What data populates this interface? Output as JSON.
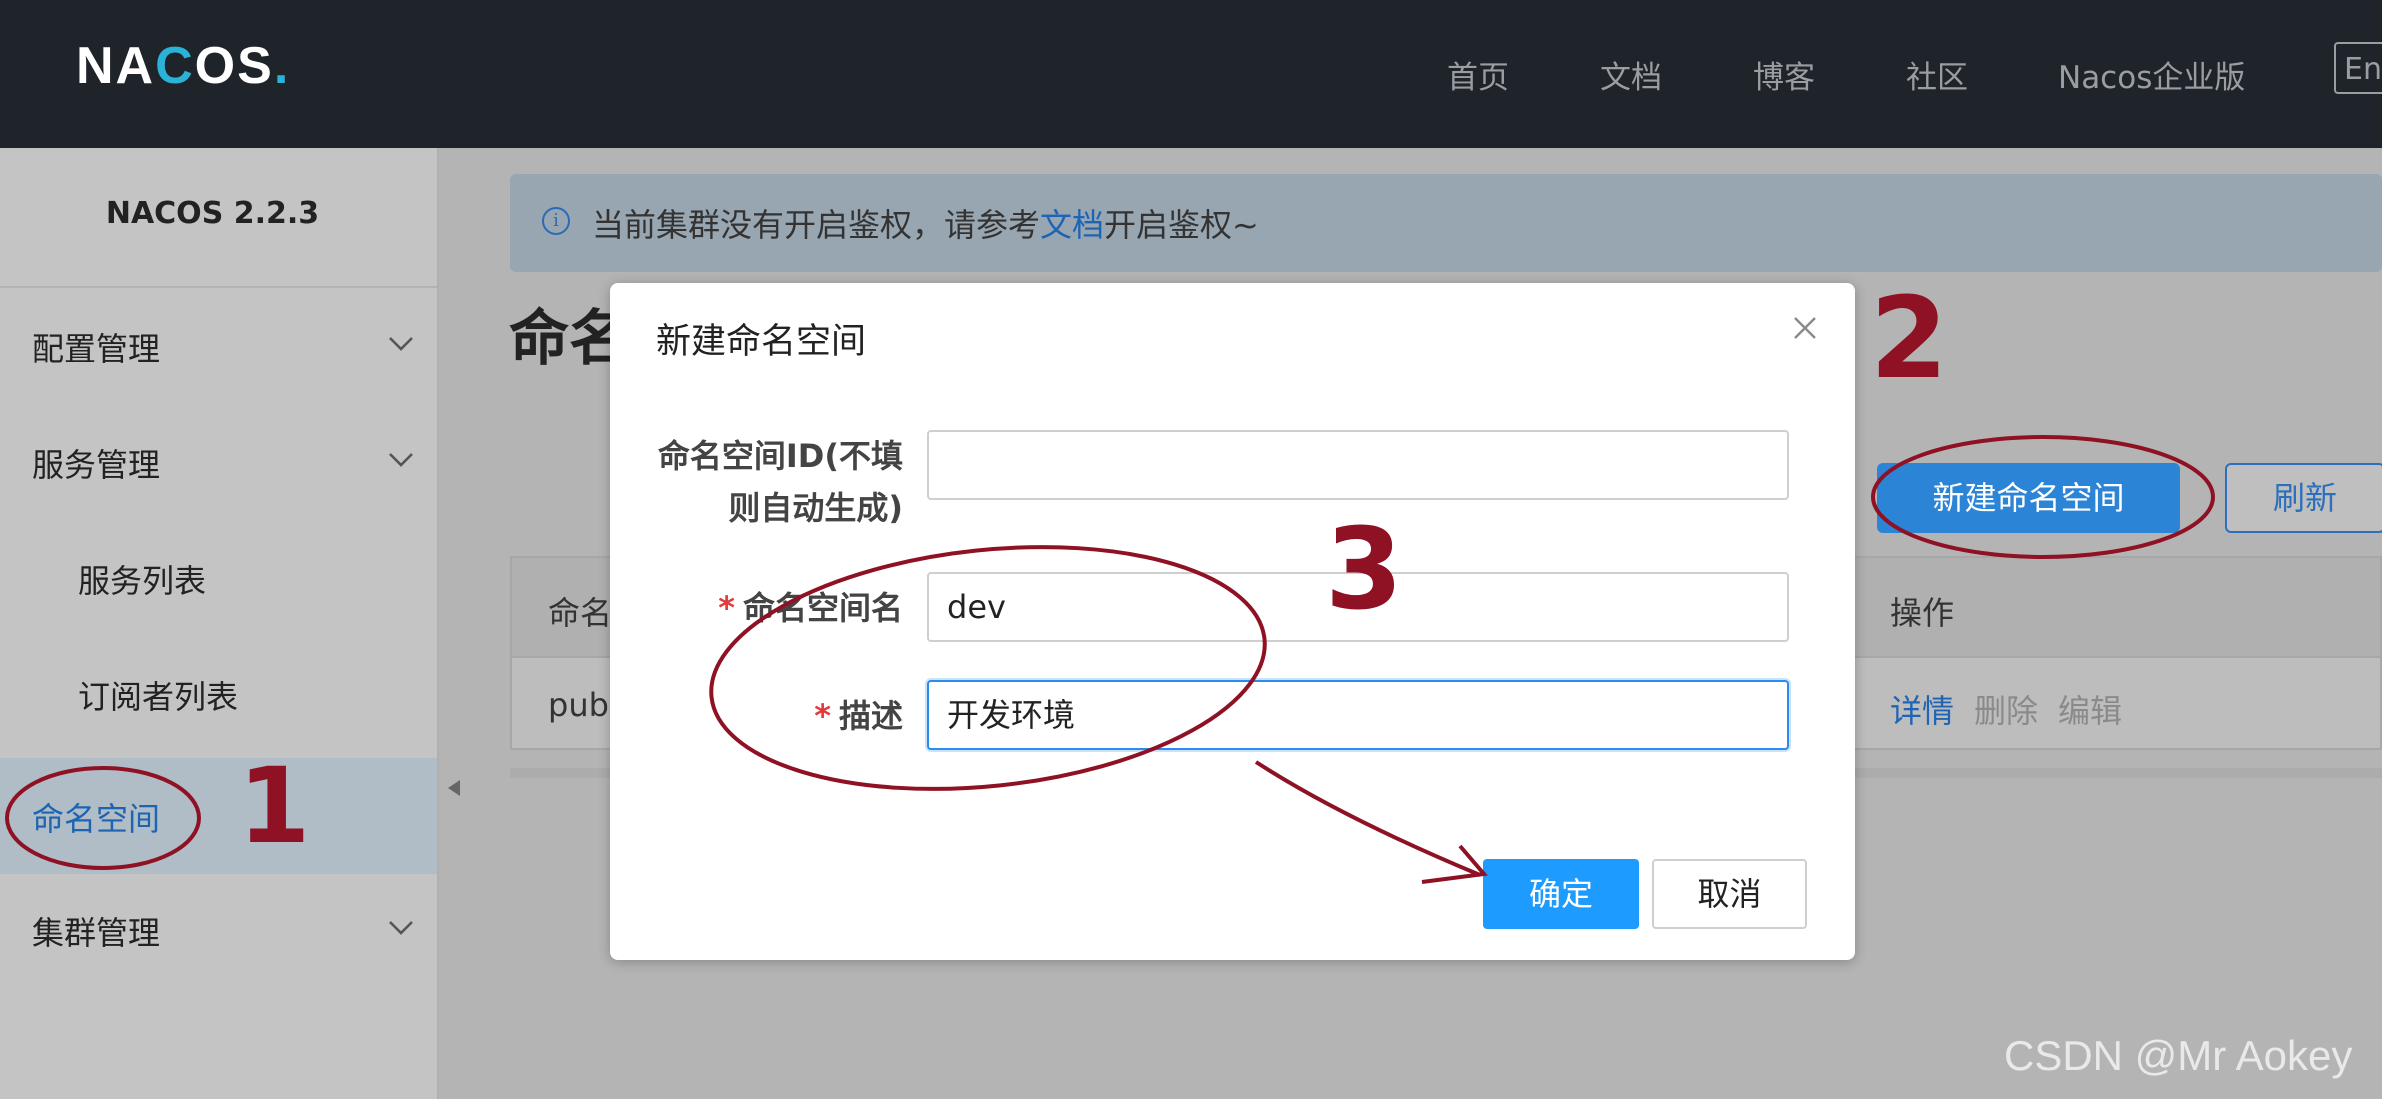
{
  "header": {
    "logo_text": "NACOS.",
    "nav": [
      "首页",
      "文档",
      "博客",
      "社区",
      "Nacos企业版"
    ],
    "lang_button": "En",
    "colors": {
      "background": "#1f232a",
      "logo_white": "#ffffff",
      "logo_accent": "#2bb3d7",
      "nav_text": "#9a9ea3"
    }
  },
  "sidebar": {
    "version": "NACOS 2.2.3",
    "items": [
      {
        "label": "配置管理",
        "expandable": true
      },
      {
        "label": "服务管理",
        "expandable": true
      },
      {
        "label": "服务列表",
        "expandable": false
      },
      {
        "label": "订阅者列表",
        "expandable": false
      },
      {
        "label": "命名空间",
        "expandable": false,
        "active": true
      },
      {
        "label": "集群管理",
        "expandable": true
      }
    ]
  },
  "notice": {
    "text_before": "当前集群没有开启鉴权，请参考",
    "link": "文档",
    "text_after": "开启鉴权~"
  },
  "page": {
    "title_visible": "命名",
    "new_button": "新建命名空间",
    "refresh_button": "刷新",
    "table": {
      "header_first_visible": "命名",
      "header_ops": "操作",
      "row_first_visible": "publ",
      "row_actions": [
        "详情",
        "删除",
        "编辑"
      ]
    }
  },
  "dialog": {
    "title": "新建命名空间",
    "fields": [
      {
        "label_line1": "命名空间ID(不填",
        "label_line2": "则自动生成)",
        "required": false,
        "value": ""
      },
      {
        "label": "命名空间名",
        "required": true,
        "value": "dev"
      },
      {
        "label": "描述",
        "required": true,
        "value": "开发环境",
        "focused": true
      }
    ],
    "ok_button": "确定",
    "cancel_button": "取消"
  },
  "annotations": {
    "numbers": [
      "1",
      "2",
      "3"
    ],
    "color": "#8e1224"
  },
  "watermark": "CSDN @Mr  Aokey"
}
